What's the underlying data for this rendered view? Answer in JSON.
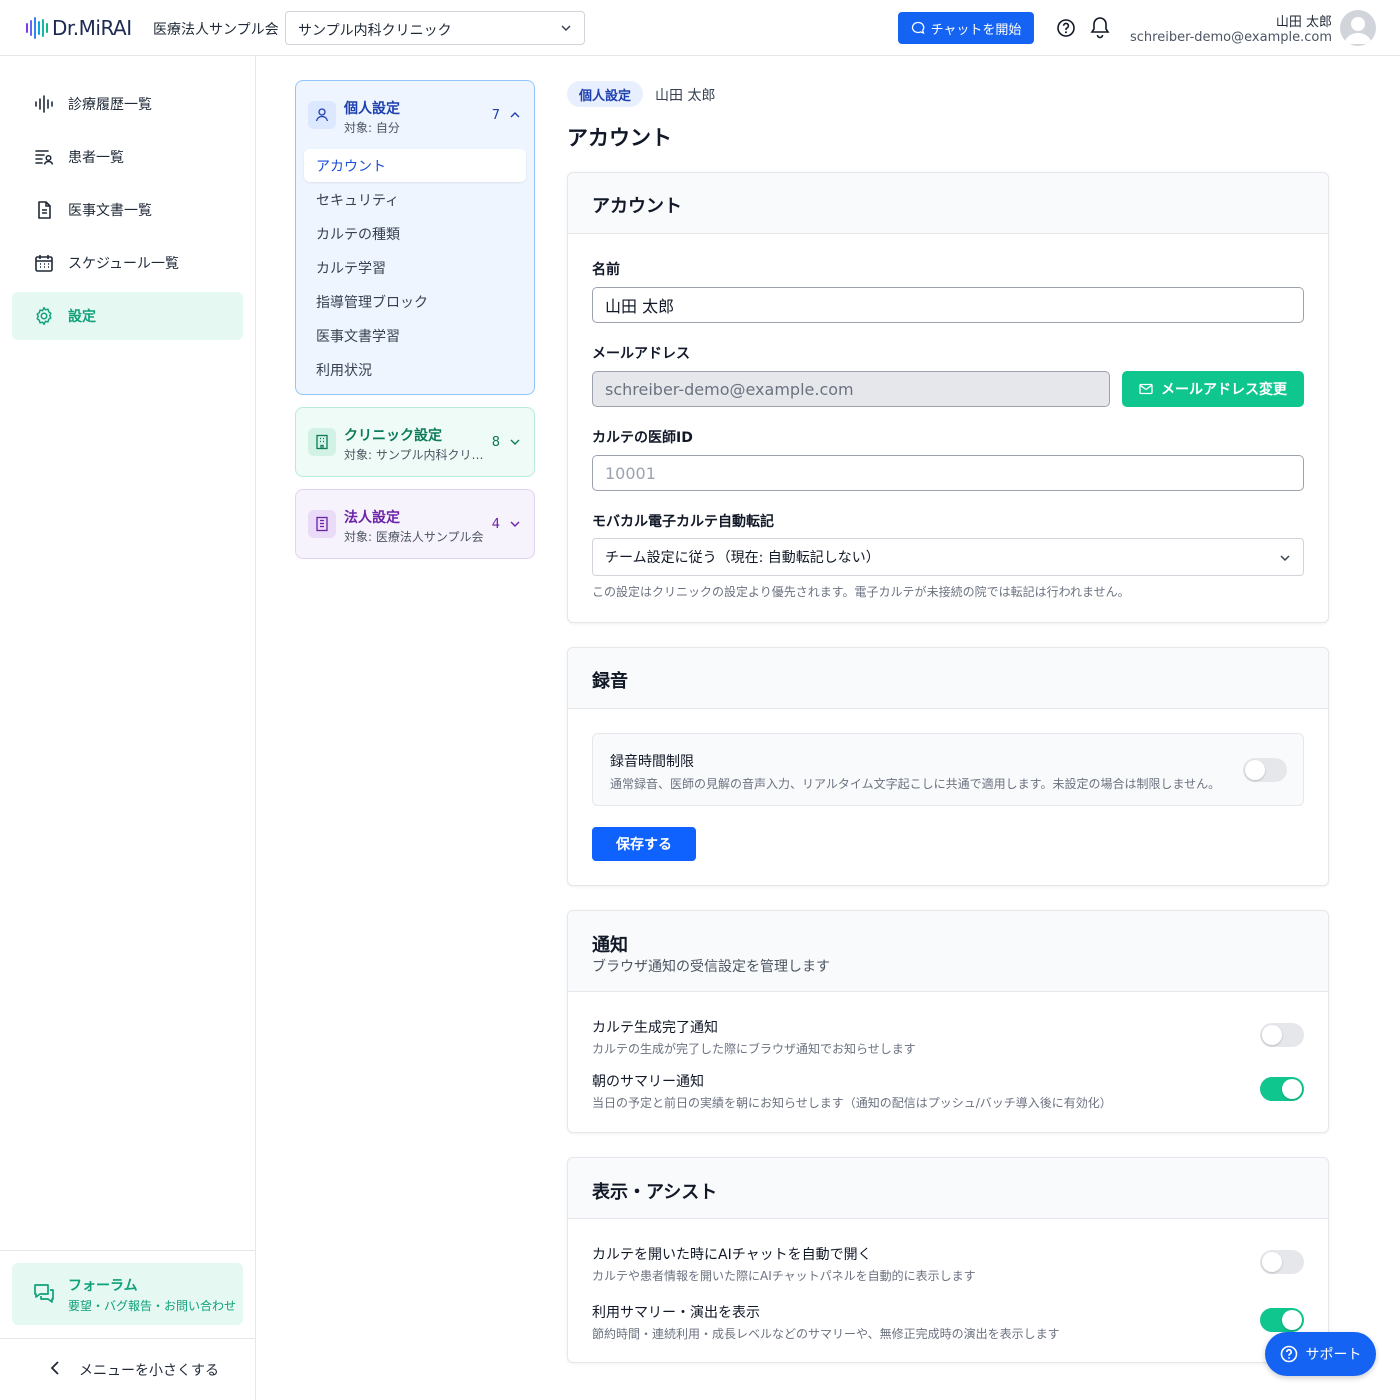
{
  "header": {
    "logo_text": "Dr.MiRAI",
    "org_name": "医療法人サンプル会",
    "clinic_select": "サンプル内科クリニック",
    "chat_button": "チャットを開始",
    "user_name": "山田 太郎",
    "user_email": "schreiber-demo@example.com"
  },
  "sidebar": {
    "items": [
      {
        "label": "診療履歴一覧",
        "icon": "waveform-icon"
      },
      {
        "label": "患者一覧",
        "icon": "patient-list-icon"
      },
      {
        "label": "医事文書一覧",
        "icon": "document-icon"
      },
      {
        "label": "スケジュール一覧",
        "icon": "calendar-icon"
      },
      {
        "label": "設定",
        "icon": "gear-icon"
      }
    ],
    "forum": {
      "title": "フォーラム",
      "subtitle": "要望・バグ報告・お問い合わせ"
    },
    "collapse_label": "メニューを小さくする"
  },
  "settings_nav": {
    "personal": {
      "title": "個人設定",
      "target": "対象: 自分",
      "count": "7",
      "items": [
        "アカウント",
        "セキュリティ",
        "カルテの種類",
        "カルテ学習",
        "指導管理ブロック",
        "医事文書学習",
        "利用状況"
      ]
    },
    "clinic": {
      "title": "クリニック設定",
      "target": "対象: サンプル内科クリニック",
      "count": "8"
    },
    "corp": {
      "title": "法人設定",
      "target": "対象: 医療法人サンプル会",
      "count": "4"
    }
  },
  "breadcrumb": {
    "badge": "個人設定",
    "user": "山田 太郎"
  },
  "page_title": "アカウント",
  "account_card": {
    "title": "アカウント",
    "name_label": "名前",
    "name_value": "山田 太郎",
    "email_label": "メールアドレス",
    "email_value": "schreiber-demo@example.com",
    "email_change_button": "メールアドレス変更",
    "doctor_id_label": "カルテの医師ID",
    "doctor_id_placeholder": "10001",
    "auto_transfer_label": "モバカル電子カルテ自動転記",
    "auto_transfer_value": "チーム設定に従う（現在: 自動転記しない）",
    "auto_transfer_hint": "この設定はクリニックの設定より優先されます。電子カルテが未接続の院では転記は行われません。"
  },
  "recording_card": {
    "title": "録音",
    "limit_title": "録音時間制限",
    "limit_desc": "通常録音、医師の見解の音声入力、リアルタイム文字起こしに共通で適用します。未設定の場合は制限しません。",
    "limit_enabled": false,
    "save_button": "保存する"
  },
  "notification_card": {
    "title": "通知",
    "subtitle": "ブラウザ通知の受信設定を管理します",
    "rows": [
      {
        "title": "カルテ生成完了通知",
        "desc": "カルテの生成が完了した際にブラウザ通知でお知らせします",
        "enabled": false
      },
      {
        "title": "朝のサマリー通知",
        "desc": "当日の予定と前日の実績を朝にお知らせします（通知の配信はプッシュ/バッチ導入後に有効化）",
        "enabled": true
      }
    ]
  },
  "display_card": {
    "title": "表示・アシスト",
    "rows": [
      {
        "title": "カルテを開いた時にAIチャットを自動で開く",
        "desc": "カルテや患者情報を開いた際にAIチャットパネルを自動的に表示します",
        "enabled": false
      },
      {
        "title": "利用サマリー・演出を表示",
        "desc": "節約時間・連続利用・成長レベルなどのサマリーや、無修正完成時の演出を表示します",
        "enabled": true
      }
    ]
  },
  "support_button": "サポート",
  "colors": {
    "primary_blue": "#1463f3",
    "accent_green": "#10c68f",
    "active_nav_bg": "#e6f8f2"
  }
}
